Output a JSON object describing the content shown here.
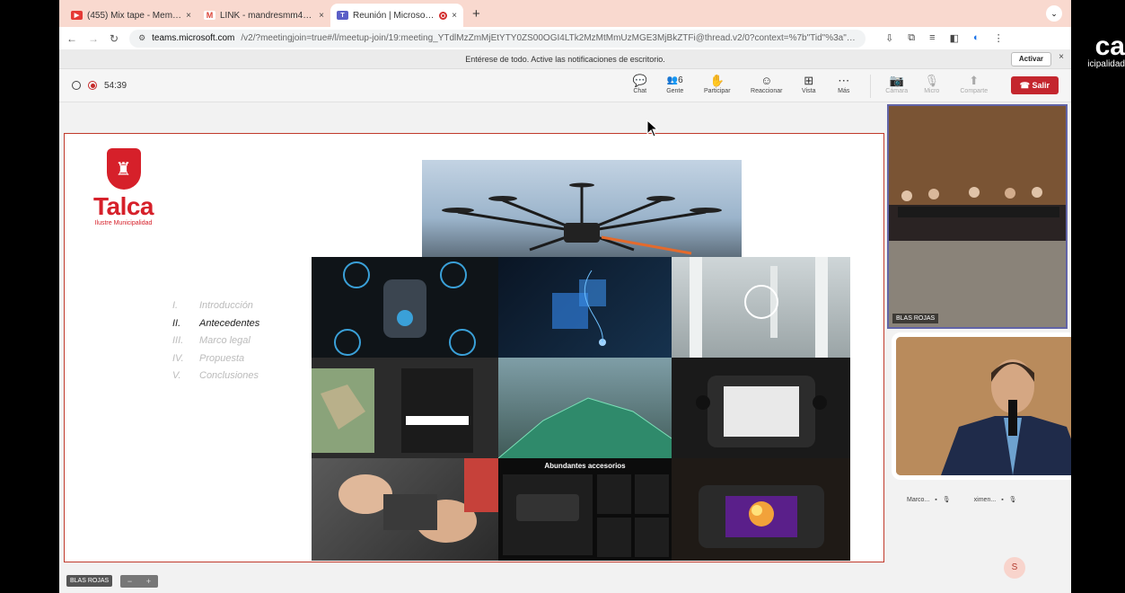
{
  "browser": {
    "tabs": [
      {
        "title": "(455) Mix tape - Memories in",
        "close": "×",
        "favicon": "youtube-icon",
        "color": "#e53935"
      },
      {
        "title": "LINK - mandresmm4@gmail.",
        "close": "×",
        "favicon": "gmail-icon",
        "color": "#db4437"
      },
      {
        "title": "Reunión | Microsoft Teams",
        "close": "×",
        "favicon": "teams-icon",
        "color": "#5b5fc7",
        "active": true
      }
    ],
    "new_tab": "+",
    "tab_menu": "⌄",
    "url_host": "teams.microsoft.com",
    "url_path": "/v2/?meetingjoin=true#/l/meetup-join/19:meeting_YTdlMzZmMjEtYTY0ZS00OGI4LTk2MzMtMmUzMGE3MjBkZTFi@thread.v2/0?context=%7b\"Tid\"%3a\"8f876d00-55a8-4662-bcec-be1232e..."
  },
  "notification": {
    "text": "Entérese de todo. Active las notificaciones de escritorio.",
    "button": "Activar",
    "close": "×"
  },
  "meeting": {
    "timer": "54:39",
    "toolbar": [
      {
        "label": "Chat",
        "icon": "chat-icon",
        "glyph": "💬"
      },
      {
        "label": "Gente",
        "icon": "people-icon",
        "glyph": "👥6"
      },
      {
        "label": "Participar",
        "icon": "raise-hand-icon",
        "glyph": "✋"
      },
      {
        "label": "Reaccionar",
        "icon": "react-icon",
        "glyph": "☺"
      },
      {
        "label": "Vista",
        "icon": "view-icon",
        "glyph": "⊞"
      },
      {
        "label": "Más",
        "icon": "more-icon",
        "glyph": "⋯"
      }
    ],
    "media": [
      {
        "label": "Cámara",
        "icon": "camera-off-icon",
        "glyph": "📷"
      },
      {
        "label": "Micro",
        "icon": "mic-off-icon",
        "glyph": "🎙"
      },
      {
        "label": "Comparte",
        "icon": "share-icon",
        "glyph": "⬆"
      }
    ],
    "leave": "Salir",
    "leave_glyph": "☎"
  },
  "slide": {
    "logo_name": "Talca",
    "logo_sub": "Ilustre Municipalidad",
    "agenda": [
      {
        "num": "I.",
        "text": "Introducción",
        "active": false
      },
      {
        "num": "II.",
        "text": "Antecedentes",
        "active": true
      },
      {
        "num": "III.",
        "text": "Marco legal",
        "active": false
      },
      {
        "num": "IV.",
        "text": "Propuesta",
        "active": false
      },
      {
        "num": "V.",
        "text": "Conclusiones",
        "active": false
      }
    ],
    "accessories_caption": "Abundantes accesorios"
  },
  "videos": {
    "room_label": "BLAS ROJAS",
    "participants": [
      "Marco...",
      "ximen..."
    ],
    "avatar": "S"
  },
  "footer": {
    "name_chip": "BLAS ROJAS",
    "zoom_minus": "−",
    "zoom_plus": "+"
  },
  "overlay": {
    "brand_big": "ca",
    "brand_small": "icipalidad"
  }
}
